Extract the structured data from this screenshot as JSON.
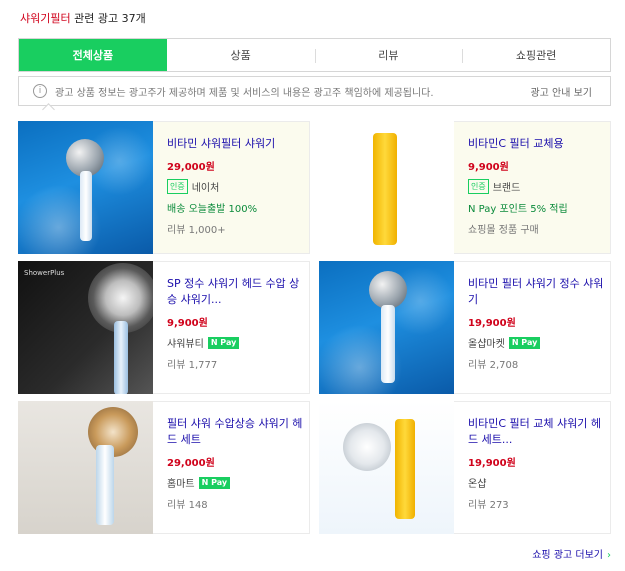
{
  "header": {
    "query": "샤워기필터",
    "suffix": "관련 광고",
    "count": "37",
    "unit": "개"
  },
  "tabs": [
    {
      "label": "전체상품",
      "active": true
    },
    {
      "label": "상품"
    },
    {
      "label": "리뷰"
    },
    {
      "label": "쇼핑관련"
    }
  ],
  "notice": {
    "text": "광고 상품 정보는 광고주가 제공하며 제품 및 서비스의 내용은 광고주 책임하에 제공됩니다.",
    "more_label": "광고 안내 보기"
  },
  "products": [
    {
      "title": "비타민 샤워필터 샤워기",
      "price": "29,000원",
      "seller": "네이처",
      "seller_badge": "인증",
      "line2": "배송 오늘출발 100%",
      "line3": "리뷰 1,000+",
      "ad": true,
      "thumb": "blue-water"
    },
    {
      "title": "비타민C 필터 교체용",
      "price": "9,900원",
      "seller": "브랜드",
      "seller_badge": "인증",
      "line2": "N Pay 포인트 5% 적립",
      "line3": "쇼핑몰 정품 구매",
      "ad": true,
      "thumb": "yellow-filter"
    },
    {
      "title": "SP 정수 샤워기 헤드 수압 상승 샤워기...",
      "price": "9,900원",
      "seller": "샤워뷰티",
      "npay": "N Pay",
      "line3": "리뷰 1,777",
      "ad": false,
      "thumb": "dark"
    },
    {
      "title": "비타민 필터 샤워기 정수 샤워기",
      "price": "19,900원",
      "seller": "올샵마켓",
      "npay": "N Pay",
      "line3": "리뷰 2,708",
      "ad": false,
      "thumb": "blue-water-2"
    },
    {
      "title": "필터 샤워 수압상승 샤워기 헤드 세트",
      "price": "29,000원",
      "seller": "홈마트",
      "npay": "N Pay",
      "line3": "리뷰 148",
      "ad": false,
      "thumb": "bath"
    },
    {
      "title": "비타민C 필터 교체 샤워기 헤드 세트...",
      "price": "19,900원",
      "seller": "온샵",
      "line3": "리뷰 273",
      "ad": false,
      "thumb": "pale"
    }
  ],
  "footer": {
    "more_label": "쇼핑 광고 더보기",
    "arrow": "›"
  }
}
